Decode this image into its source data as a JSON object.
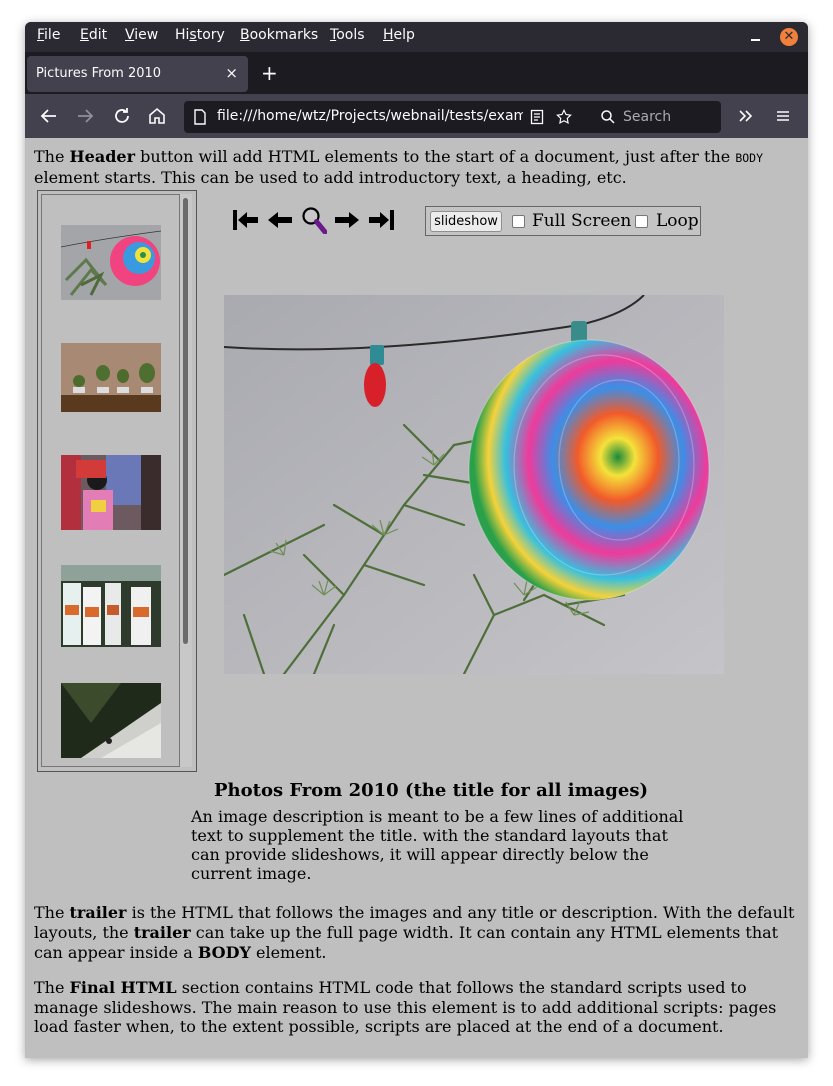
{
  "menubar": {
    "items": [
      {
        "label_ul": "F",
        "label_rest": "ile"
      },
      {
        "label_ul": "E",
        "label_rest": "dit"
      },
      {
        "label_ul": "V",
        "label_rest": "iew"
      },
      {
        "label_pre": "Hi",
        "label_ul": "s",
        "label_rest": "tory"
      },
      {
        "label_ul": "B",
        "label_rest": "ookmarks"
      },
      {
        "label_ul": "T",
        "label_rest": "ools"
      },
      {
        "label_ul": "H",
        "label_rest": "elp"
      }
    ]
  },
  "tab": {
    "title": "Pictures From 2010",
    "close": "×"
  },
  "new_tab": "+",
  "urlbar": {
    "url": "file:///home/wtz/Projects/webnail/tests/examp"
  },
  "searchbar": {
    "placeholder": "Search"
  },
  "content": {
    "header_text": {
      "p1": "The ",
      "b1": "Header",
      "p2": " button will add HTML elements to the start of a document, just after the ",
      "code": "BODY",
      "p3": " element starts. This can be used to add introductory text, a heading, etc."
    },
    "slideshow": {
      "button": "slideshow",
      "fullscreen": "Full Screen",
      "loop": "Loop"
    },
    "caption_title": "Photos From 2010 (the title for all images)",
    "caption_desc": "An image description is meant to be a few lines of additional text to supplement the title. with the standard layouts that can provide slideshows, it will appear directly below the current image.",
    "trailer": {
      "p1": "The ",
      "b1": "trailer",
      "p2": " is the HTML that follows the images and any title or description. With the default layouts, the ",
      "b2": "trailer",
      "p3": " can take up the full page width. It can contain any HTML elements that can appear inside a ",
      "b3": "BODY",
      "p4": " element."
    },
    "final": {
      "p1": "The ",
      "b1": "Final HTML",
      "p2": " section contains HTML code that follows the standard scripts used to manage slideshows. The main reason to use this element is to add additional scripts: pages load faster when, to the extent possible, scripts are placed at the end of a document."
    }
  },
  "colors": {
    "accent_close": "#f0803c",
    "chrome_dark": "#2b2a33",
    "page_bg": "#bfbfbf"
  }
}
